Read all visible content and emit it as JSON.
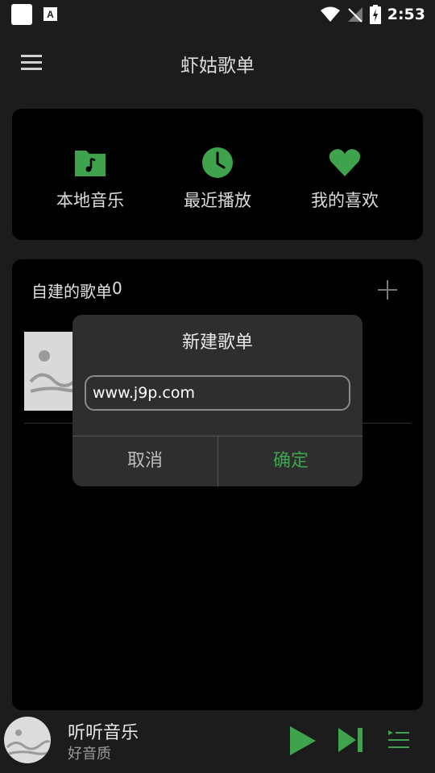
{
  "status_bar": {
    "time": "2:53"
  },
  "header": {
    "title": "虾姑歌单"
  },
  "quick_access": [
    {
      "label": "本地音乐",
      "icon": "music-folder-icon"
    },
    {
      "label": "最近播放",
      "icon": "clock-icon"
    },
    {
      "label": "我的喜欢",
      "icon": "heart-icon"
    }
  ],
  "playlists": {
    "title": "自建的歌单",
    "count": "0"
  },
  "dialog": {
    "title": "新建歌单",
    "input_value": "www.j9p.com",
    "cancel_label": "取消",
    "confirm_label": "确定"
  },
  "player": {
    "song": "听听音乐",
    "subtitle": "好音质"
  },
  "colors": {
    "accent": "#3fa34d",
    "background": "#1c1c1c",
    "card": "#000000",
    "dialog": "#2e2e2e"
  }
}
